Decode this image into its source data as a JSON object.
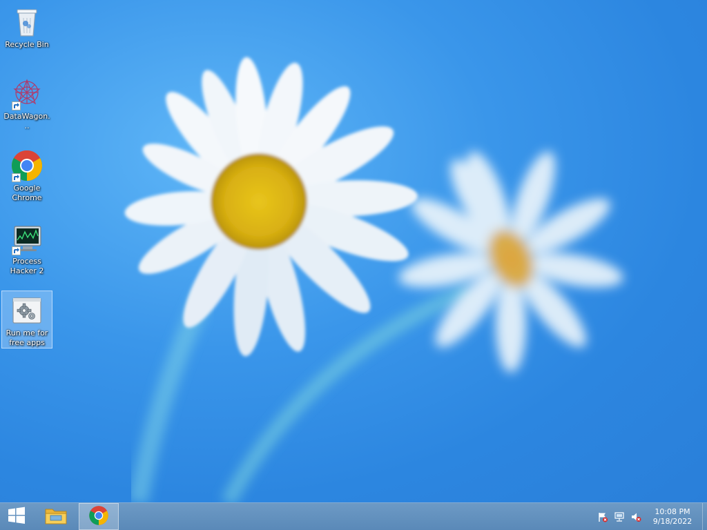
{
  "desktop": {
    "icons": [
      {
        "label": "Recycle Bin",
        "icon": "recycle-bin-icon"
      },
      {
        "label": "DataWagon...",
        "icon": "datawagon-icon"
      },
      {
        "label": "Google Chrome",
        "icon": "chrome-icon"
      },
      {
        "label": "Process Hacker 2",
        "icon": "process-hacker-icon"
      },
      {
        "label": "Run me for free apps",
        "icon": "settings-app-icon"
      }
    ]
  },
  "taskbar": {
    "start": {
      "icon": "windows-start-icon"
    },
    "pinned": [
      {
        "icon": "file-explorer-icon"
      },
      {
        "icon": "chrome-icon"
      }
    ],
    "tray": {
      "icons": [
        "action-center-flag-icon",
        "network-icon",
        "volume-muted-icon"
      ],
      "time": "10:08 PM",
      "date": "9/18/2022"
    }
  },
  "colors": {
    "taskbar": "#5a89b8",
    "desktop": "#3a96ea"
  }
}
